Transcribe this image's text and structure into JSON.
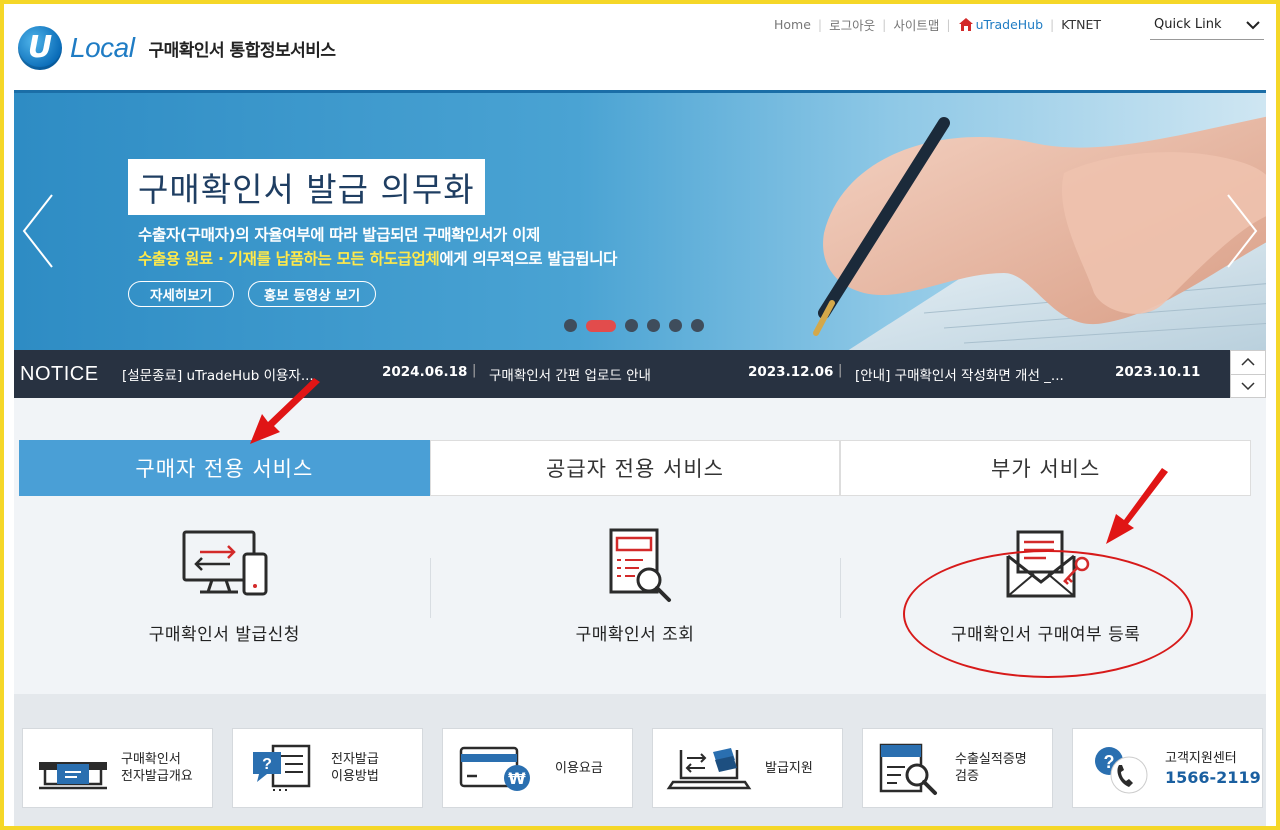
{
  "header": {
    "logo_mark": "U",
    "logo_text": "Local",
    "site_title": "구매확인서 통합정보서비스",
    "nav": [
      "Home",
      "로그아웃",
      "사이트맵"
    ],
    "utradehub": "uTradeHub",
    "ktnet": "KTNET",
    "quicklink": "Quick Link"
  },
  "banner": {
    "title": "구매확인서 발급 의무화",
    "line1": "수출자(구매자)의 자율여부에 따라 발급되던 구매확인서가 이제",
    "line2_highlight": "수출용 원료 · 기재를 납품하는 모든 하도급업체",
    "line2_rest": "에게 의무적으로 발급됩니다",
    "btn_detail": "자세히보기",
    "btn_video": "홍보 동영상 보기",
    "slide_count": 6,
    "active_slide": 2
  },
  "notice": {
    "label": "NOTICE",
    "items": [
      {
        "title": "[설문종료] uTradeHub 이용자...",
        "date": "2024.06.18"
      },
      {
        "title": "구매확인서 간편 업로드 안내",
        "date": "2023.12.06"
      },
      {
        "title": "[안내] 구매확인서 작성화면 개선 _...",
        "date": "2023.10.11"
      }
    ]
  },
  "tabs": [
    {
      "label": "구매자 전용 서비스",
      "active": true
    },
    {
      "label": "공급자 전용 서비스",
      "active": false
    },
    {
      "label": "부가 서비스",
      "active": false
    }
  ],
  "services": [
    {
      "label": "구매확인서 발급신청",
      "icon": "transfer-monitor-icon"
    },
    {
      "label": "구매확인서 조회",
      "icon": "document-search-icon"
    },
    {
      "label": "구매확인서 구매여부 등록",
      "icon": "envelope-key-icon"
    }
  ],
  "quick": [
    {
      "line1": "구매확인서",
      "line2": "전자발급개요",
      "icon": "atm-card-icon"
    },
    {
      "line1": "전자발급",
      "line2": "이용방법",
      "icon": "help-chat-icon"
    },
    {
      "line1": "이용요금",
      "line2": "",
      "icon": "won-card-icon"
    },
    {
      "line1": "발급지원",
      "line2": "",
      "icon": "laptop-transfer-icon"
    },
    {
      "line1": "수출실적증명",
      "line2": "검증",
      "icon": "doc-magnifier-icon"
    },
    {
      "line1": "고객지원센터",
      "line2": "1566-2119",
      "icon": "support-phone-icon"
    }
  ],
  "colors": {
    "accent": "#4a9fd6",
    "notice_bg": "#283241",
    "highlight": "#ffe94a",
    "annotation_red": "#d71a1a",
    "frame": "#f5d728"
  }
}
